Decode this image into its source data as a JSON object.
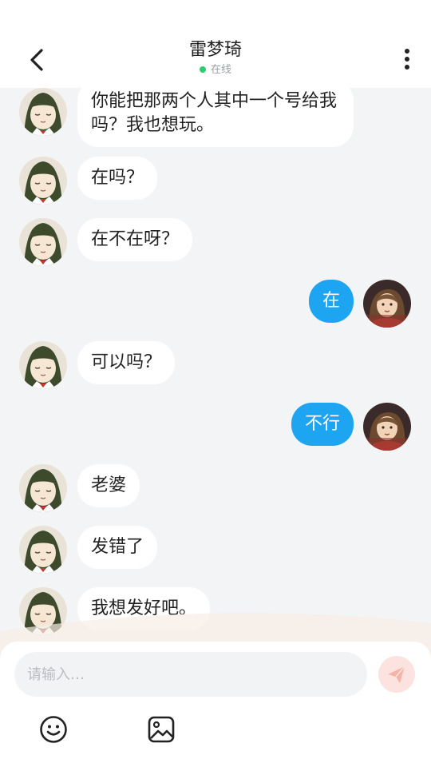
{
  "header": {
    "title": "雷梦琦",
    "status": "在线"
  },
  "messages": [
    {
      "side": "in",
      "text": "你能把那两个人其中一个号给我吗？我也想玩。"
    },
    {
      "side": "in",
      "text": "在吗？"
    },
    {
      "side": "in",
      "text": "在不在呀？"
    },
    {
      "side": "out",
      "text": "在"
    },
    {
      "side": "in",
      "text": "可以吗？"
    },
    {
      "side": "out",
      "text": "不行"
    },
    {
      "side": "in",
      "text": "老婆"
    },
    {
      "side": "in",
      "text": "发错了"
    },
    {
      "side": "in",
      "text": "我想发好吧。"
    }
  ],
  "composer": {
    "placeholder": "请输入…",
    "icons": [
      "emoji-icon",
      "image-icon",
      "send-icon"
    ]
  },
  "colors": {
    "outgoing_bubble": "#1ea5f2",
    "incoming_bubble": "#ffffff",
    "online_dot": "#2ecc71",
    "send_button": "#fde3df"
  }
}
